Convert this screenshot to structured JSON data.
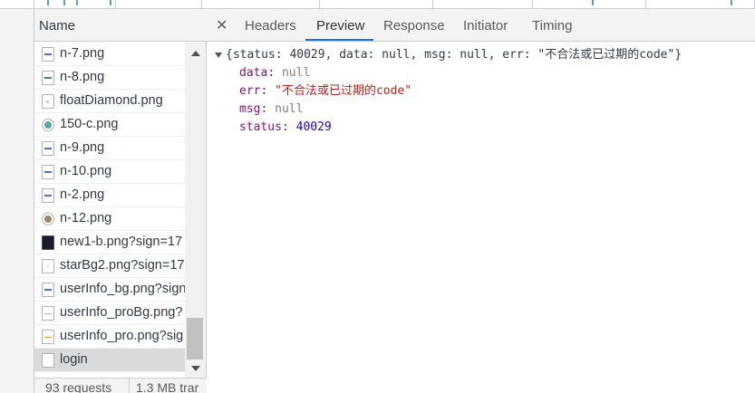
{
  "name_pane": {
    "header": "Name",
    "files": [
      {
        "name": "n-7.png",
        "icon": "png-file-icon"
      },
      {
        "name": "n-8.png",
        "icon": "png-file-icon"
      },
      {
        "name": "floatDiamond.png",
        "icon": "png-file-icon"
      },
      {
        "name": "150-c.png",
        "icon": "image-round-icon"
      },
      {
        "name": "n-9.png",
        "icon": "png-file-icon"
      },
      {
        "name": "n-10.png",
        "icon": "png-file-icon"
      },
      {
        "name": "n-2.png",
        "icon": "png-file-icon"
      },
      {
        "name": "n-12.png",
        "icon": "image-round-icon"
      },
      {
        "name": "new1-b.png?sign=17",
        "icon": "dark-image-icon"
      },
      {
        "name": "starBg2.png?sign=17",
        "icon": "png-file-icon"
      },
      {
        "name": "userInfo_bg.png?sign",
        "icon": "png-file-icon"
      },
      {
        "name": "userInfo_proBg.png?",
        "icon": "png-file-icon"
      },
      {
        "name": "userInfo_pro.png?sig",
        "icon": "png-file-icon"
      },
      {
        "name": "login",
        "icon": "document-icon"
      }
    ],
    "selected_index": 13,
    "status": {
      "requests": "93 requests",
      "transferred": "1.3 MB trar"
    }
  },
  "detail_pane": {
    "tabs": [
      {
        "label": "Headers"
      },
      {
        "label": "Preview"
      },
      {
        "label": "Response"
      },
      {
        "label": "Initiator"
      },
      {
        "label": "Timing"
      }
    ],
    "active_tab": "Preview",
    "preview": {
      "summary": "{status: 40029, data: null, msg: null, err: \"不合法或已过期的code\"}",
      "props": [
        {
          "key": "data",
          "value": "null",
          "type": "null"
        },
        {
          "key": "err",
          "value": "\"不合法或已过期的code\"",
          "type": "string"
        },
        {
          "key": "msg",
          "value": "null",
          "type": "null"
        },
        {
          "key": "status",
          "value": "40029",
          "type": "number"
        }
      ]
    }
  },
  "colors": {
    "tab_underline": "#1a73e8",
    "key": "#881280",
    "number": "#1c00cf",
    "string": "#c41a16"
  }
}
